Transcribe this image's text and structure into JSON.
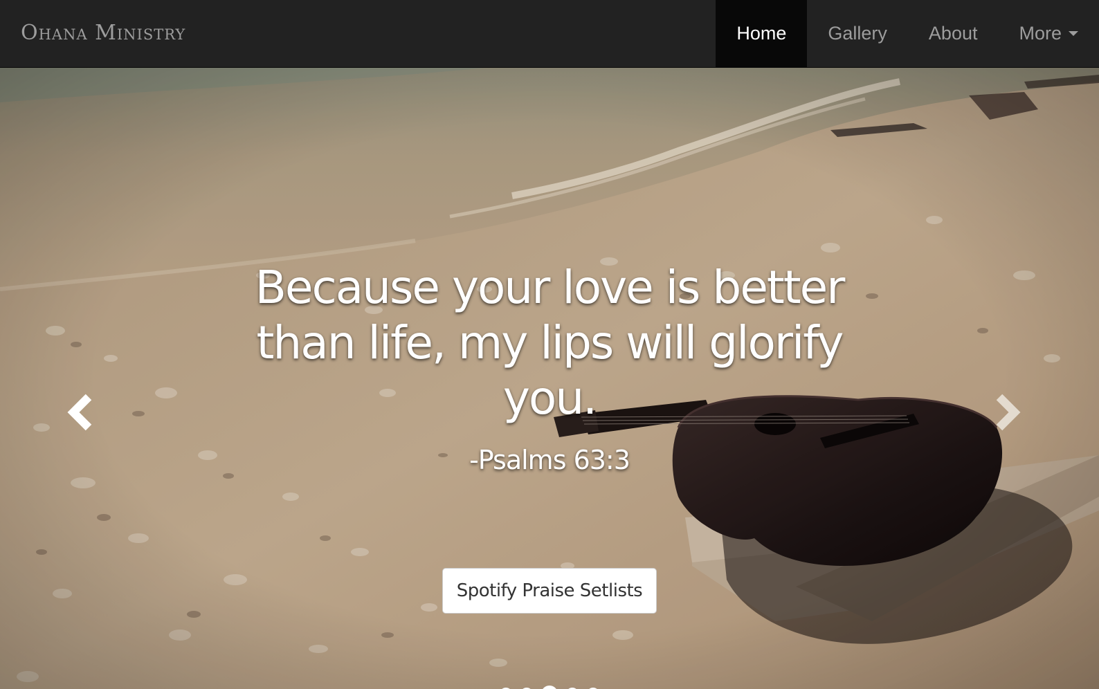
{
  "navbar": {
    "brand": "Ohana Ministry",
    "items": [
      {
        "label": "Home",
        "active": true
      },
      {
        "label": "Gallery",
        "active": false
      },
      {
        "label": "About",
        "active": false
      },
      {
        "label": "More",
        "active": false,
        "dropdown": true
      }
    ]
  },
  "hero": {
    "background_image": "beach-with-guitar-photo",
    "quote": "Because your love is better than life, my lips will glorify you.",
    "reference": "-Psalms 63:3",
    "button_label": "Spotify Praise Setlists",
    "slide_count": 5,
    "active_slide": 3,
    "prev_icon": "chevron-left-icon",
    "next_icon": "chevron-right-icon"
  },
  "colors": {
    "navbar_bg": "#222222",
    "nav_active_bg": "#080808",
    "nav_text": "#9d9d9d",
    "nav_active_text": "#ffffff",
    "caption_text": "#ffffff"
  }
}
